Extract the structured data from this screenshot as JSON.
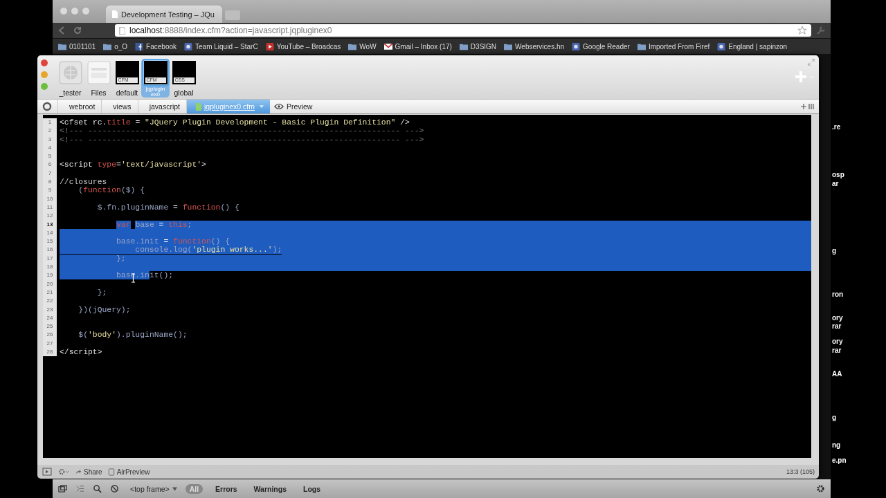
{
  "browser": {
    "tab_title": "Development Testing – JQu",
    "url_host": "localhost",
    "url_rest": ":8888/index.cfm?action=javascript.jqpluginex0",
    "bookmarks": [
      {
        "label": "0101101",
        "kind": "folder"
      },
      {
        "label": "o_O",
        "kind": "folder"
      },
      {
        "label": "Facebook",
        "kind": "facebook"
      },
      {
        "label": "Team Liquid – StarC",
        "kind": "site"
      },
      {
        "label": "YouTube – Broadcas",
        "kind": "video"
      },
      {
        "label": "WoW",
        "kind": "folder"
      },
      {
        "label": "Gmail – Inbox (17)",
        "kind": "mail"
      },
      {
        "label": "D3SIGN",
        "kind": "folder"
      },
      {
        "label": "Webservices.hn",
        "kind": "folder"
      },
      {
        "label": "Google Reader",
        "kind": "site"
      },
      {
        "label": "Imported From Firef",
        "kind": "folder"
      },
      {
        "label": "England | sapinzon",
        "kind": "site"
      }
    ]
  },
  "editor_window": {
    "projects": [
      {
        "label": "_tester",
        "kind": "globe",
        "selected": false
      },
      {
        "label": "Files",
        "kind": "box",
        "selected": false
      },
      {
        "label": "default",
        "kind": "file",
        "badge": "CFM",
        "selected": false
      },
      {
        "label": "jqplugin ex0",
        "kind": "file",
        "badge": "CFM",
        "selected": true
      },
      {
        "label": "global",
        "kind": "file",
        "badge": "CSS",
        "selected": false
      }
    ],
    "breadcrumbs": [
      {
        "label": "webroot",
        "selected": false
      },
      {
        "label": "views",
        "selected": false
      },
      {
        "label": "javascript",
        "selected": false
      },
      {
        "label": "jqpluginex0.cfm",
        "selected": true
      }
    ],
    "preview_label": "Preview",
    "code_lines": [
      {
        "number": "1",
        "current": false,
        "selected_eol": false,
        "tokens": [
          {
            "t": "<cfset rc.",
            "kind": "tag",
            "selected": false
          },
          {
            "t": "title",
            "kind": "attr",
            "selected": false
          },
          {
            "t": " = ",
            "kind": "op",
            "selected": false
          },
          {
            "t": "\"JQuery Plugin Development - Basic Plugin Definition\"",
            "kind": "string",
            "selected": false
          },
          {
            "t": " />",
            "kind": "tag",
            "selected": false
          }
        ]
      },
      {
        "number": "2",
        "current": false,
        "selected_eol": false,
        "tokens": [
          {
            "t": "<!--- ------------------------------------------------------------------ --->",
            "kind": "comment",
            "selected": false
          }
        ]
      },
      {
        "number": "3",
        "current": false,
        "selected_eol": false,
        "tokens": [
          {
            "t": "<!--- ------------------------------------------------------------------ --->",
            "kind": "comment",
            "selected": false
          }
        ]
      },
      {
        "number": "4",
        "current": false,
        "selected_eol": false
      },
      {
        "number": "5",
        "current": false,
        "selected_eol": false
      },
      {
        "number": "6",
        "current": false,
        "selected_eol": false,
        "tokens": [
          {
            "t": "<script ",
            "kind": "tag",
            "selected": false
          },
          {
            "t": "type",
            "kind": "attr",
            "selected": false
          },
          {
            "t": "=",
            "kind": "op",
            "selected": false
          },
          {
            "t": "'text/javascript'",
            "kind": "string",
            "selected": false
          },
          {
            "t": ">",
            "kind": "tag",
            "selected": false
          }
        ]
      },
      {
        "number": "7",
        "current": false,
        "selected_eol": false
      },
      {
        "number": "8",
        "current": false,
        "selected_eol": false,
        "tokens": [
          {
            "t": "//closures",
            "kind": "note",
            "selected": false
          }
        ]
      },
      {
        "number": "9",
        "current": false,
        "selected_eol": false,
        "tokens": [
          {
            "t": "    (",
            "kind": "ident",
            "selected": false
          },
          {
            "t": "function",
            "kind": "keyword",
            "selected": false
          },
          {
            "t": "($) {",
            "kind": "ident",
            "selected": false
          }
        ]
      },
      {
        "number": "10",
        "current": false,
        "selected_eol": false
      },
      {
        "number": "11",
        "current": false,
        "selected_eol": false,
        "tokens": [
          {
            "t": "        $.fn.pluginName ",
            "kind": "ident",
            "selected": false
          },
          {
            "t": "= ",
            "kind": "op",
            "selected": false
          },
          {
            "t": "function",
            "kind": "keyword",
            "selected": false
          },
          {
            "t": "() {",
            "kind": "ident",
            "selected": false
          }
        ]
      },
      {
        "number": "12",
        "current": false,
        "selected_eol": false
      },
      {
        "number": "13",
        "current": true,
        "selected_eol": true,
        "selection_from_text": true,
        "tokens": [
          {
            "t": "            var",
            "kind": "keyword",
            "selected": true
          },
          {
            "t": " base ",
            "kind": "ident",
            "selected": true
          },
          {
            "t": "= ",
            "kind": "op",
            "selected": true
          },
          {
            "t": "this",
            "kind": "keyword",
            "selected": true
          },
          {
            "t": ";",
            "kind": "ident",
            "selected": true
          }
        ]
      },
      {
        "number": "14",
        "current": false,
        "selected_eol": true
      },
      {
        "number": "15",
        "current": false,
        "selected_eol": true,
        "tokens": [
          {
            "t": "            base.init ",
            "kind": "ident",
            "selected": true
          },
          {
            "t": "= ",
            "kind": "op",
            "selected": true
          },
          {
            "t": "function",
            "kind": "keyword",
            "selected": true
          },
          {
            "t": "() {",
            "kind": "ident",
            "selected": true
          }
        ]
      },
      {
        "number": "16",
        "current": false,
        "selected_eol": true,
        "tokens": [
          {
            "t": "                console.log(",
            "kind": "ident",
            "selected": true
          },
          {
            "t": "'plugin works...'",
            "kind": "string",
            "selected": true
          },
          {
            "t": ");",
            "kind": "ident",
            "selected": true
          }
        ]
      },
      {
        "number": "17",
        "current": false,
        "selected_eol": true,
        "tokens": [
          {
            "t": "            };",
            "kind": "ident",
            "selected": true
          }
        ]
      },
      {
        "number": "18",
        "current": false,
        "selected_eol": true
      },
      {
        "number": "19",
        "current": false,
        "selected_eol": false,
        "tokens": [
          {
            "t": "            base.in",
            "kind": "ident",
            "selected": true
          },
          {
            "t": "it();",
            "kind": "ident",
            "selected": false
          }
        ]
      },
      {
        "number": "20",
        "current": false,
        "selected_eol": false
      },
      {
        "number": "21",
        "current": false,
        "selected_eol": false,
        "tokens": [
          {
            "t": "        };",
            "kind": "ident",
            "selected": false
          }
        ]
      },
      {
        "number": "22",
        "current": false,
        "selected_eol": false
      },
      {
        "number": "23",
        "current": false,
        "selected_eol": false,
        "tokens": [
          {
            "t": "    })(jQuery);",
            "kind": "ident",
            "selected": false
          }
        ]
      },
      {
        "number": "24",
        "current": false,
        "selected_eol": false
      },
      {
        "number": "25",
        "current": false,
        "selected_eol": false
      },
      {
        "number": "26",
        "current": false,
        "selected_eol": false,
        "tokens": [
          {
            "t": "    $(",
            "kind": "ident",
            "selected": false
          },
          {
            "t": "'body'",
            "kind": "string",
            "selected": false
          },
          {
            "t": ").pluginName();",
            "kind": "ident",
            "selected": false
          }
        ]
      },
      {
        "number": "27",
        "current": false,
        "selected_eol": false
      },
      {
        "number": "28",
        "current": false,
        "selected_eol": false,
        "tokens": [
          {
            "t": "</script>",
            "kind": "tag",
            "selected": false
          }
        ]
      }
    ],
    "status_bar": {
      "share": "Share",
      "airpreview": "AirPreview",
      "position": "13:3 (105)"
    }
  },
  "devtools": {
    "frame": "<top frame>",
    "filters": [
      {
        "label": "All",
        "selected": true
      },
      {
        "label": "Errors",
        "selected": false
      },
      {
        "label": "Warnings",
        "selected": false
      },
      {
        "label": "Logs",
        "selected": false
      }
    ]
  },
  "desktop_labels": [
    ".re",
    "osp",
    "ar",
    "g",
    "ron",
    "ory",
    "rar",
    "ory",
    "rar",
    "AA",
    "g",
    "ng",
    "e.pn"
  ]
}
